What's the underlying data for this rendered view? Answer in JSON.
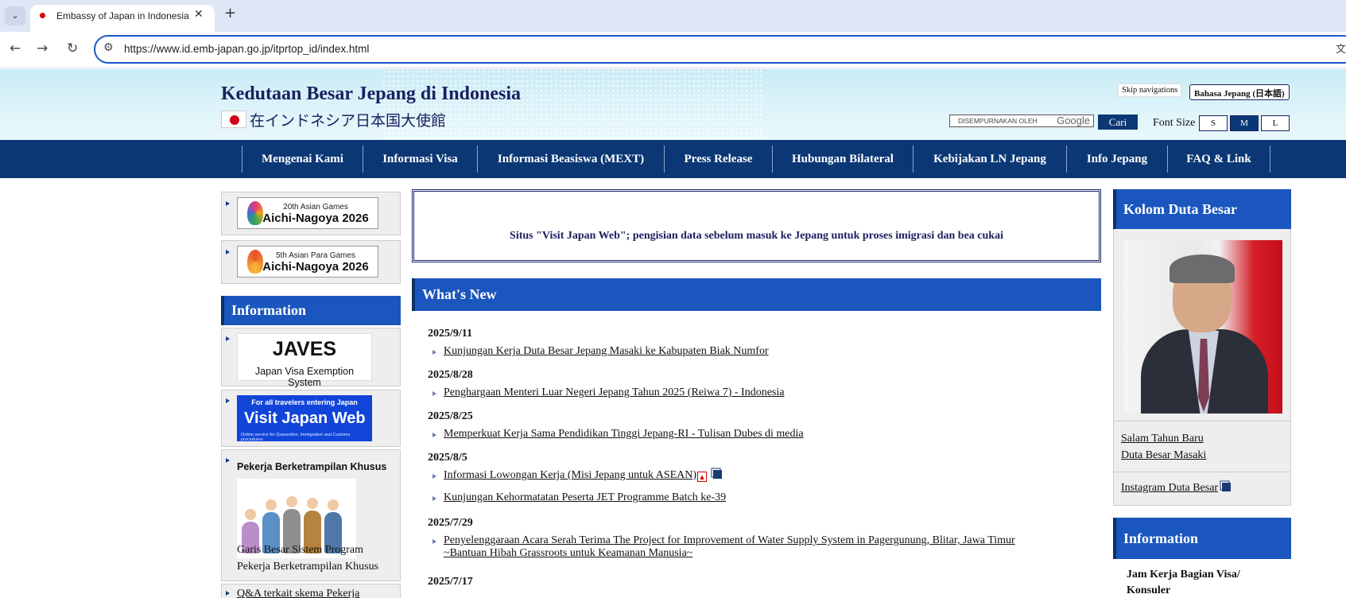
{
  "browser": {
    "tab_title": "Embassy of Japan in Indonesia",
    "url": "https://www.id.emb-japan.go.jp/itprtop_id/index.html",
    "icons": [
      "chevron-down-icon",
      "close-icon",
      "plus-icon",
      "back-arrow-icon",
      "forward-arrow-icon",
      "reload-icon",
      "site-settings-icon",
      "translate-icon"
    ]
  },
  "header": {
    "title": "Kedutaan Besar Jepang di Indonesia",
    "subtitle": "在インドネシア日本国大使館",
    "skip_nav": "Skip navigations",
    "lang_button": "Bahasa Jepang (日本語)",
    "search_placeholder": "DISEMPURNAKAN OLEH",
    "search_brand": "Google",
    "search_button": "Cari",
    "font_size_label": "Font Size",
    "font_sizes": [
      "S",
      "M",
      "L"
    ],
    "font_size_selected": "M"
  },
  "nav": {
    "items": [
      "Mengenai Kami",
      "Informasi Visa",
      "Informasi Beasiswa (MEXT)",
      "Press Release",
      "Hubungan Bilateral",
      "Kebijakan LN Jepang",
      "Info Jepang",
      "FAQ & Link"
    ]
  },
  "left": {
    "banner1": {
      "line1": "20th Asian Games",
      "line2": "Aichi-Nagoya 2026"
    },
    "banner2": {
      "line1": "5th Asian Para Games",
      "line2": "Aichi-Nagoya 2026"
    },
    "info_title": "Information",
    "javes": {
      "title": "JAVES",
      "subtitle": "Japan Visa Exemption System"
    },
    "vjw": {
      "top": "For all travelers entering Japan",
      "main": "Visit Japan Web",
      "bottom": "Online service for Quarantine, Immigration and Customs procedures"
    },
    "pekerja": {
      "title": "Pekerja Berketrampilan Khusus",
      "caption_line1": "Garis Besar Sistem Program",
      "caption_line2": "Pekerja Berketrampilan Khusus"
    },
    "next_item": "Q&A terkait skema Pekerja"
  },
  "center": {
    "notice": "Situs \"Visit Japan Web\"; pengisian data sebelum masuk ke Jepang untuk proses imigrasi dan bea cukai",
    "whats_new_title": "What's New",
    "news": [
      {
        "date": "2025/9/11",
        "items": [
          "Kunjungan Kerja Duta Besar Jepang Masaki ke Kabupaten Biak Numfor"
        ]
      },
      {
        "date": "2025/8/28",
        "items": [
          "Penghargaan Menteri Luar Negeri Jepang Tahun 2025 (Reiwa 7) - Indonesia"
        ]
      },
      {
        "date": "2025/8/25",
        "items": [
          "Memperkuat Kerja Sama Pendidikan Tinggi Jepang-RI - Tulisan Dubes di media"
        ]
      },
      {
        "date": "2025/8/5",
        "items": [
          "Informasi Lowongan Kerja (Misi Jepang untuk ASEAN)",
          "Kunjungan Kehormatatan Peserta JET Programme Batch ke-39"
        ]
      },
      {
        "date": "2025/7/29",
        "items": [
          "Penyelenggaraan Acara Serah Terima The Project for Improvement of Water Supply System in Pagergunung, Blitar, Jawa Timur",
          "~Bantuan Hibah Grassroots untuk Keamanan Manusia~"
        ]
      },
      {
        "date": "2025/7/17",
        "items": []
      }
    ]
  },
  "right": {
    "ambassador_title": "Kolom Duta Besar",
    "link1_line1": "Salam Tahun Baru",
    "link1_line2": "Duta Besar Masaki",
    "link2": "Instagram Duta Besar",
    "info_title": "Information",
    "info_item_line1": "Jam Kerja Bagian Visa/",
    "info_item_line2": "Konsuler"
  },
  "colors": {
    "nav_bg": "#0b3875",
    "section_blue": "#1a56bd",
    "title_navy": "#1a2060",
    "header_bg": "#c9ecf5"
  }
}
